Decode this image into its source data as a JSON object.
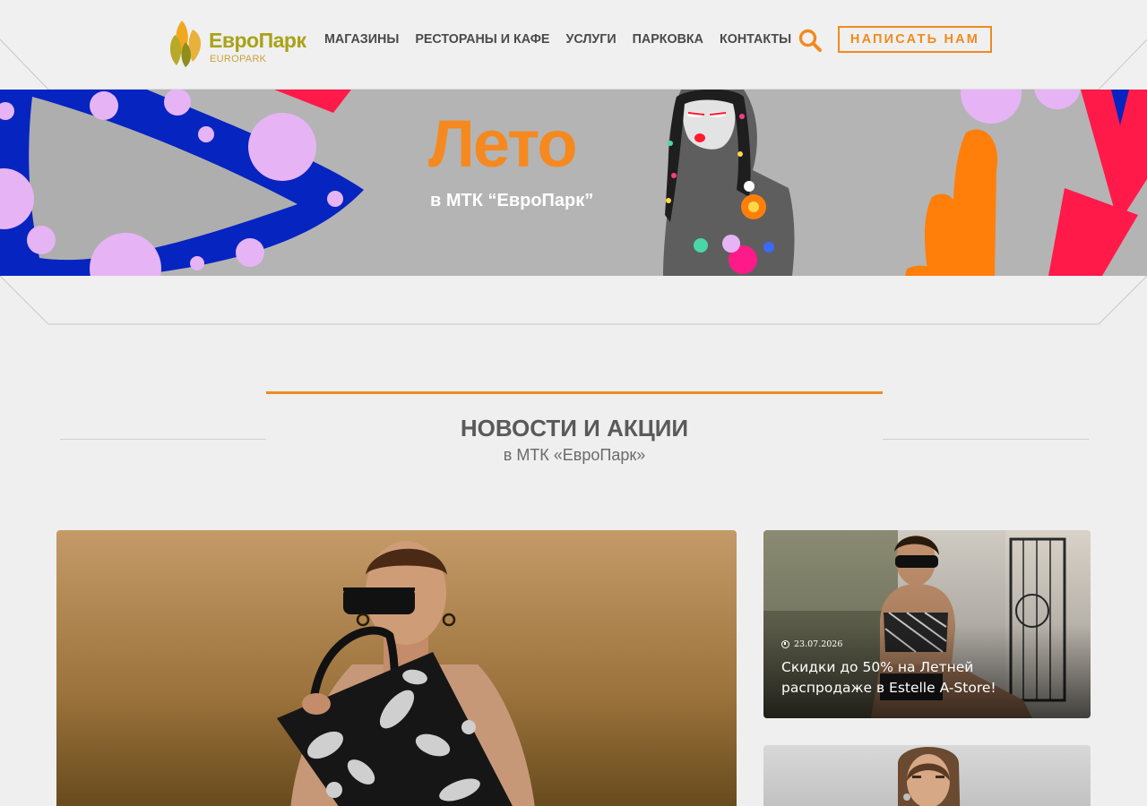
{
  "brand": {
    "name": "ЕвроПарк",
    "latin": "EUROPARK"
  },
  "nav": {
    "items": [
      {
        "label": "МАГАЗИНЫ"
      },
      {
        "label": "РЕСТОРАНЫ И КАФЕ"
      },
      {
        "label": "УСЛУГИ"
      },
      {
        "label": "ПАРКОВКА"
      },
      {
        "label": "КОНТАКТЫ"
      }
    ],
    "cta": "НАПИСАТЬ НАМ"
  },
  "hero": {
    "title": "Лето",
    "subtitle": "в МТК “ЕвроПарк”"
  },
  "section": {
    "title": "НОВОСТИ И АКЦИИ",
    "subtitle": "в МТК «ЕвроПарк»"
  },
  "news": [
    {
      "date": "",
      "title": ""
    },
    {
      "date": "23.07.2026",
      "title": "Скидки до 50% на Летней распродаже в Estelle A-Store!"
    },
    {
      "date": "",
      "title": ""
    }
  ],
  "colors": {
    "accent": "#f08a1e",
    "brand_olive": "#a9a218",
    "nav_text": "#4a4a4a",
    "background": "#efefef"
  },
  "icons": {
    "search": "search-icon",
    "clock": "clock-icon",
    "logo": "leaf-logo-icon"
  }
}
